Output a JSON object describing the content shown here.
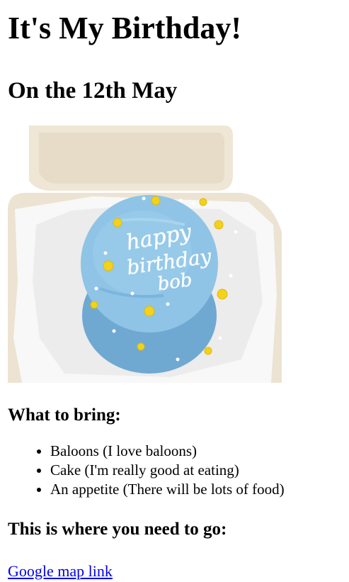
{
  "page": {
    "title": "It's My Birthday!",
    "subtitle": "On the 12th May"
  },
  "image": {
    "cake_text_line1": "happy",
    "cake_text_line2": "birthday",
    "cake_text_line3": "bob",
    "colors": {
      "container": "#efe6d6",
      "paper": "#f7f7f7",
      "frosting": "#8fc4e6",
      "frosting_dark": "#79b3da",
      "flower": "#f2d21a",
      "piping": "#ffffff"
    }
  },
  "bring": {
    "heading": "What to bring:",
    "items": [
      "Baloons (I love baloons)",
      "Cake (I'm really good at eating)",
      "An appetite (There will be lots of food)"
    ]
  },
  "directions": {
    "heading": "This is where you need to go:",
    "link_text": "Google map link"
  }
}
